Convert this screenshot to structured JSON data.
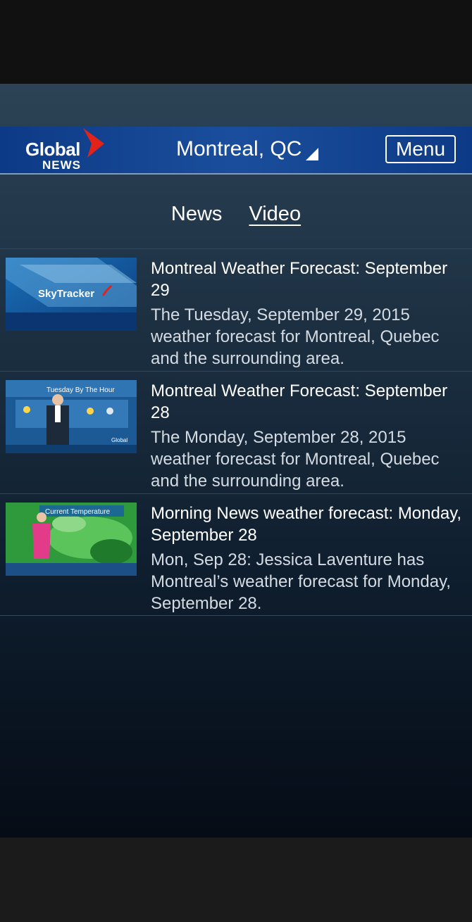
{
  "header": {
    "logo_word": "Global",
    "logo_sub": "NEWS",
    "location": "Montreal, QC",
    "menu_label": "Menu"
  },
  "tabs": [
    {
      "label": "News",
      "active": false
    },
    {
      "label": "Video",
      "active": true
    }
  ],
  "videos": [
    {
      "thumbnail_text": "SkyTracker",
      "title": "Montreal Weather Forecast: September 29",
      "description": "The Tuesday, September 29, 2015 weather forecast for Montreal, Quebec and the surrounding area."
    },
    {
      "thumbnail_text": "Tuesday By The Hour",
      "title": "Montreal Weather Forecast: September 28",
      "description": "The Monday, September 28, 2015 weather forecast for Montreal, Quebec and the surrounding area."
    },
    {
      "thumbnail_text": "Current Temperature",
      "title": "Morning News weather forecast: Monday, September 28",
      "description": "Mon, Sep 28: Jessica Laventure has Montreal’s weather forecast for Monday, September 28."
    }
  ],
  "colors": {
    "header_bg": "#1a4e9c",
    "logo_red": "#e2231a",
    "screen_top": "#2c4356",
    "screen_bottom": "#050c16"
  }
}
